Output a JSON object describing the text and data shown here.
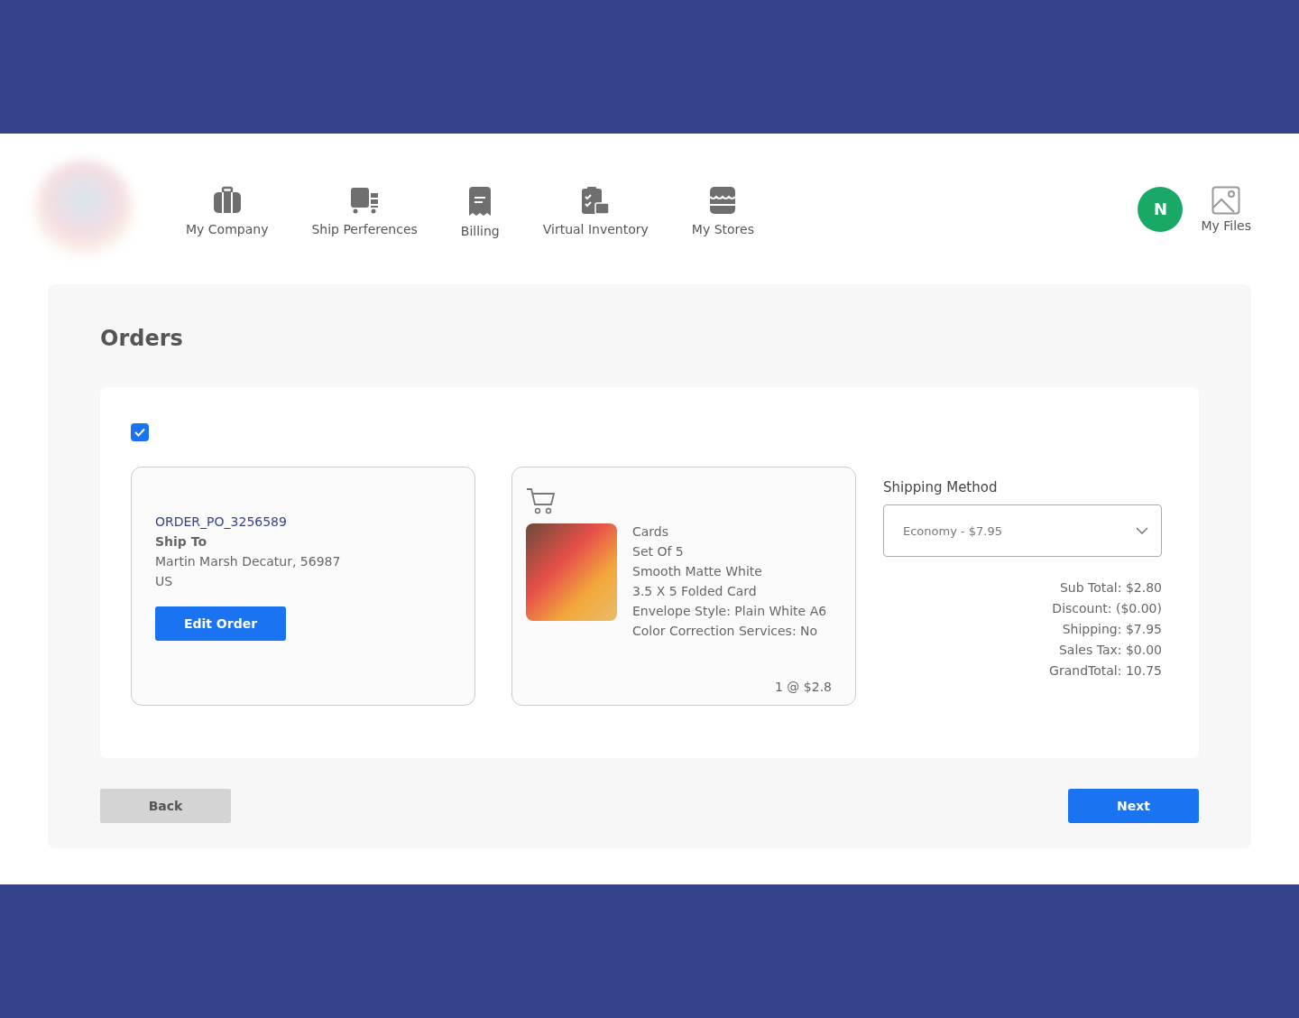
{
  "nav": [
    {
      "label": "My Company"
    },
    {
      "label": "Ship Perferences"
    },
    {
      "label": "Billing"
    },
    {
      "label": "Virtual Inventory"
    },
    {
      "label": "My Stores"
    }
  ],
  "user": {
    "initial": "N",
    "files_label": "My Files"
  },
  "page": {
    "title": "Orders"
  },
  "order": {
    "checked": true,
    "number": "ORDER_PO_3256589",
    "ship_to_label": "Ship To",
    "address": "Martin Marsh Decatur, 56987",
    "country": "US",
    "edit_button": "Edit Order",
    "item_details": [
      "Cards",
      "Set Of 5",
      "Smooth Matte White",
      "3.5 X 5 Folded Card",
      "Envelope Style: Plain White A6",
      "Color Correction Services: No"
    ],
    "quantity_price": "1 @ $2.8"
  },
  "shipping": {
    "label": "Shipping Method",
    "value": "Economy - $7.95"
  },
  "totals": [
    "Sub Total: $2.80",
    "Discount: ($0.00)",
    "Shipping: $7.95",
    "Sales Tax: $0.00",
    "GrandTotal: 10.75"
  ],
  "buttons": {
    "back": "Back",
    "next": "Next"
  }
}
